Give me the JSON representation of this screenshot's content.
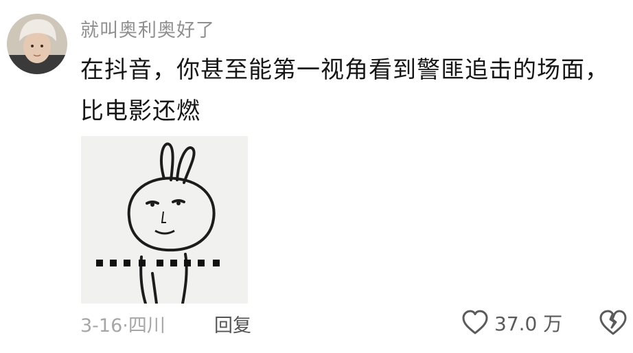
{
  "comment": {
    "username": "就叫奥利奥好了",
    "text": "在抖音，你甚至能第一视角看到警匪追击的场面，比电影还燃",
    "sticker_icon": "bunny-meme-sticker",
    "date": "3-16",
    "separator": "·",
    "location": "四川",
    "reply_label": "回复",
    "like_icon": "heart-outline-icon",
    "like_count": "37.0 万",
    "dislike_icon": "broken-heart-icon"
  },
  "colors": {
    "username": "#8f8f8f",
    "text": "#161616",
    "meta": "#a6a6a6",
    "icon": "#5a5a5a"
  }
}
